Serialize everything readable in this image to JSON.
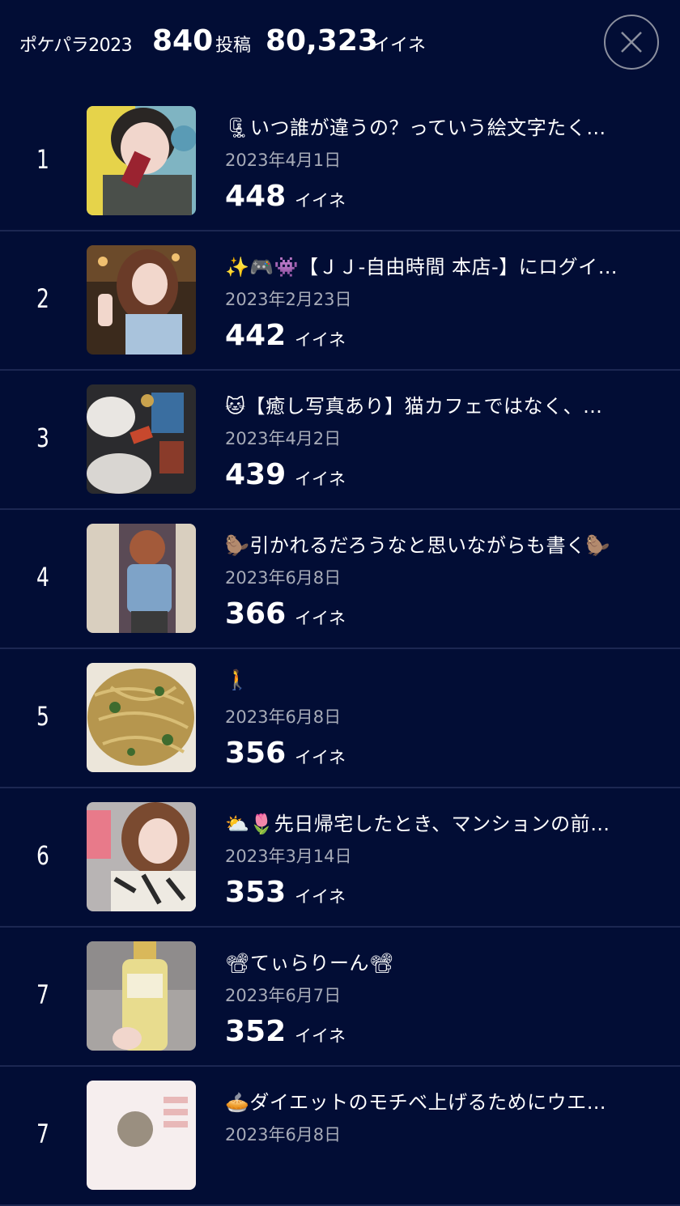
{
  "header": {
    "title": "ポケパラ2023",
    "posts_count": "840",
    "posts_unit": "投稿",
    "likes_count": "80,323",
    "likes_unit": "イイネ"
  },
  "close_icon": "close-icon",
  "posts": [
    {
      "rank": "1",
      "title": "いつ誰が違うの？っていう絵文字たく…",
      "title_emoji": "🗜",
      "date": "2023年4月1日",
      "likes": "448",
      "likes_unit": "イイネ"
    },
    {
      "rank": "2",
      "title": "【ＪＪ-自由時間 本店-】にログイ…",
      "title_emoji": "✨🎮👾",
      "date": "2023年2月23日",
      "likes": "442",
      "likes_unit": "イイネ"
    },
    {
      "rank": "3",
      "title": "【癒し写真あり】猫カフェではなく、…",
      "title_emoji": "🐱",
      "date": "2023年4月2日",
      "likes": "439",
      "likes_unit": "イイネ"
    },
    {
      "rank": "4",
      "title": "引かれるだろうなと思いながらも書く🦫",
      "title_emoji": "🦫",
      "date": "2023年6月8日",
      "likes": "366",
      "likes_unit": "イイネ"
    },
    {
      "rank": "5",
      "title": "",
      "title_emoji": "🚶",
      "date": "2023年6月8日",
      "likes": "356",
      "likes_unit": "イイネ"
    },
    {
      "rank": "6",
      "title": "先日帰宅したとき、マンションの前…",
      "title_emoji": "⛅🌷",
      "date": "2023年3月14日",
      "likes": "353",
      "likes_unit": "イイネ"
    },
    {
      "rank": "7",
      "title": "てぃらりーん📽",
      "title_emoji": "📽",
      "date": "2023年6月7日",
      "likes": "352",
      "likes_unit": "イイネ"
    },
    {
      "rank": "7",
      "title": "ダイエットのモチベ上げるためにウエ…",
      "title_emoji": "🥧",
      "date": "2023年6月8日",
      "likes": "",
      "likes_unit": ""
    }
  ]
}
